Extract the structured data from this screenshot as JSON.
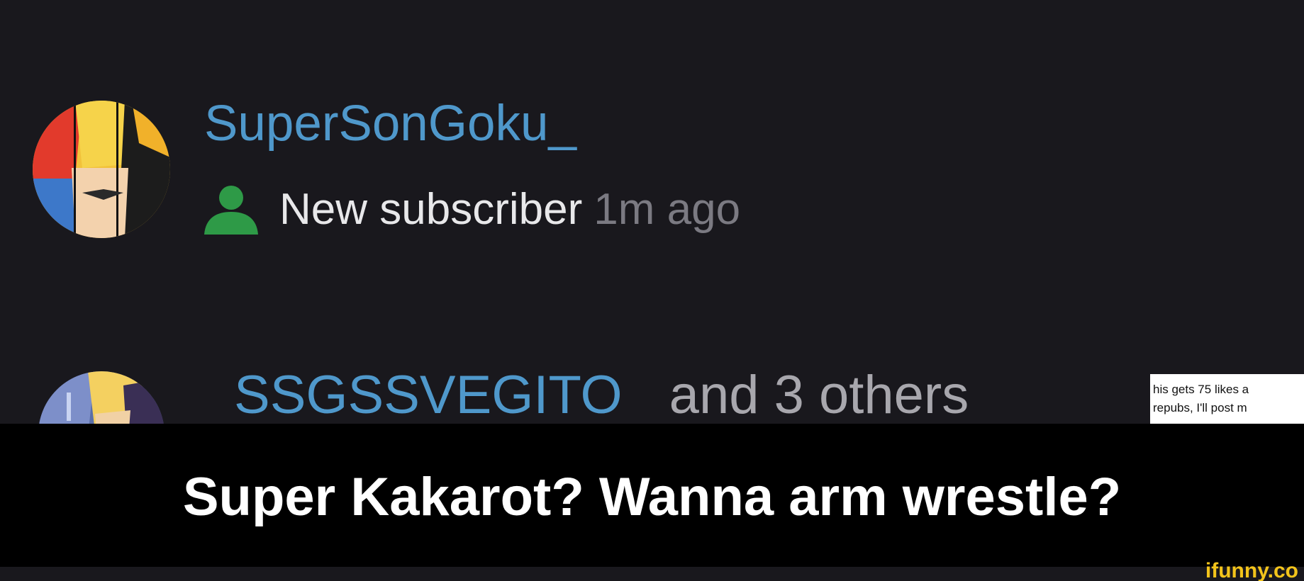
{
  "notifications": [
    {
      "username": "SuperSonGoku_",
      "event_label": "New subscriber",
      "time": "1m ago",
      "icon": "person-icon"
    },
    {
      "username": "SSGSSVEGITO",
      "others": "and 3 others",
      "thumbnail": {
        "line1": "his gets 75 likes a",
        "line2": "repubs, I'll post m"
      }
    }
  ],
  "caption": "Super Kakarot? Wanna arm wrestle?",
  "watermark": "ifunny.co",
  "colors": {
    "background": "#19181d",
    "username": "#4f98cb",
    "subscriber_icon": "#2e9a47",
    "caption_bar": "#000000",
    "watermark": "#f3c41b"
  }
}
